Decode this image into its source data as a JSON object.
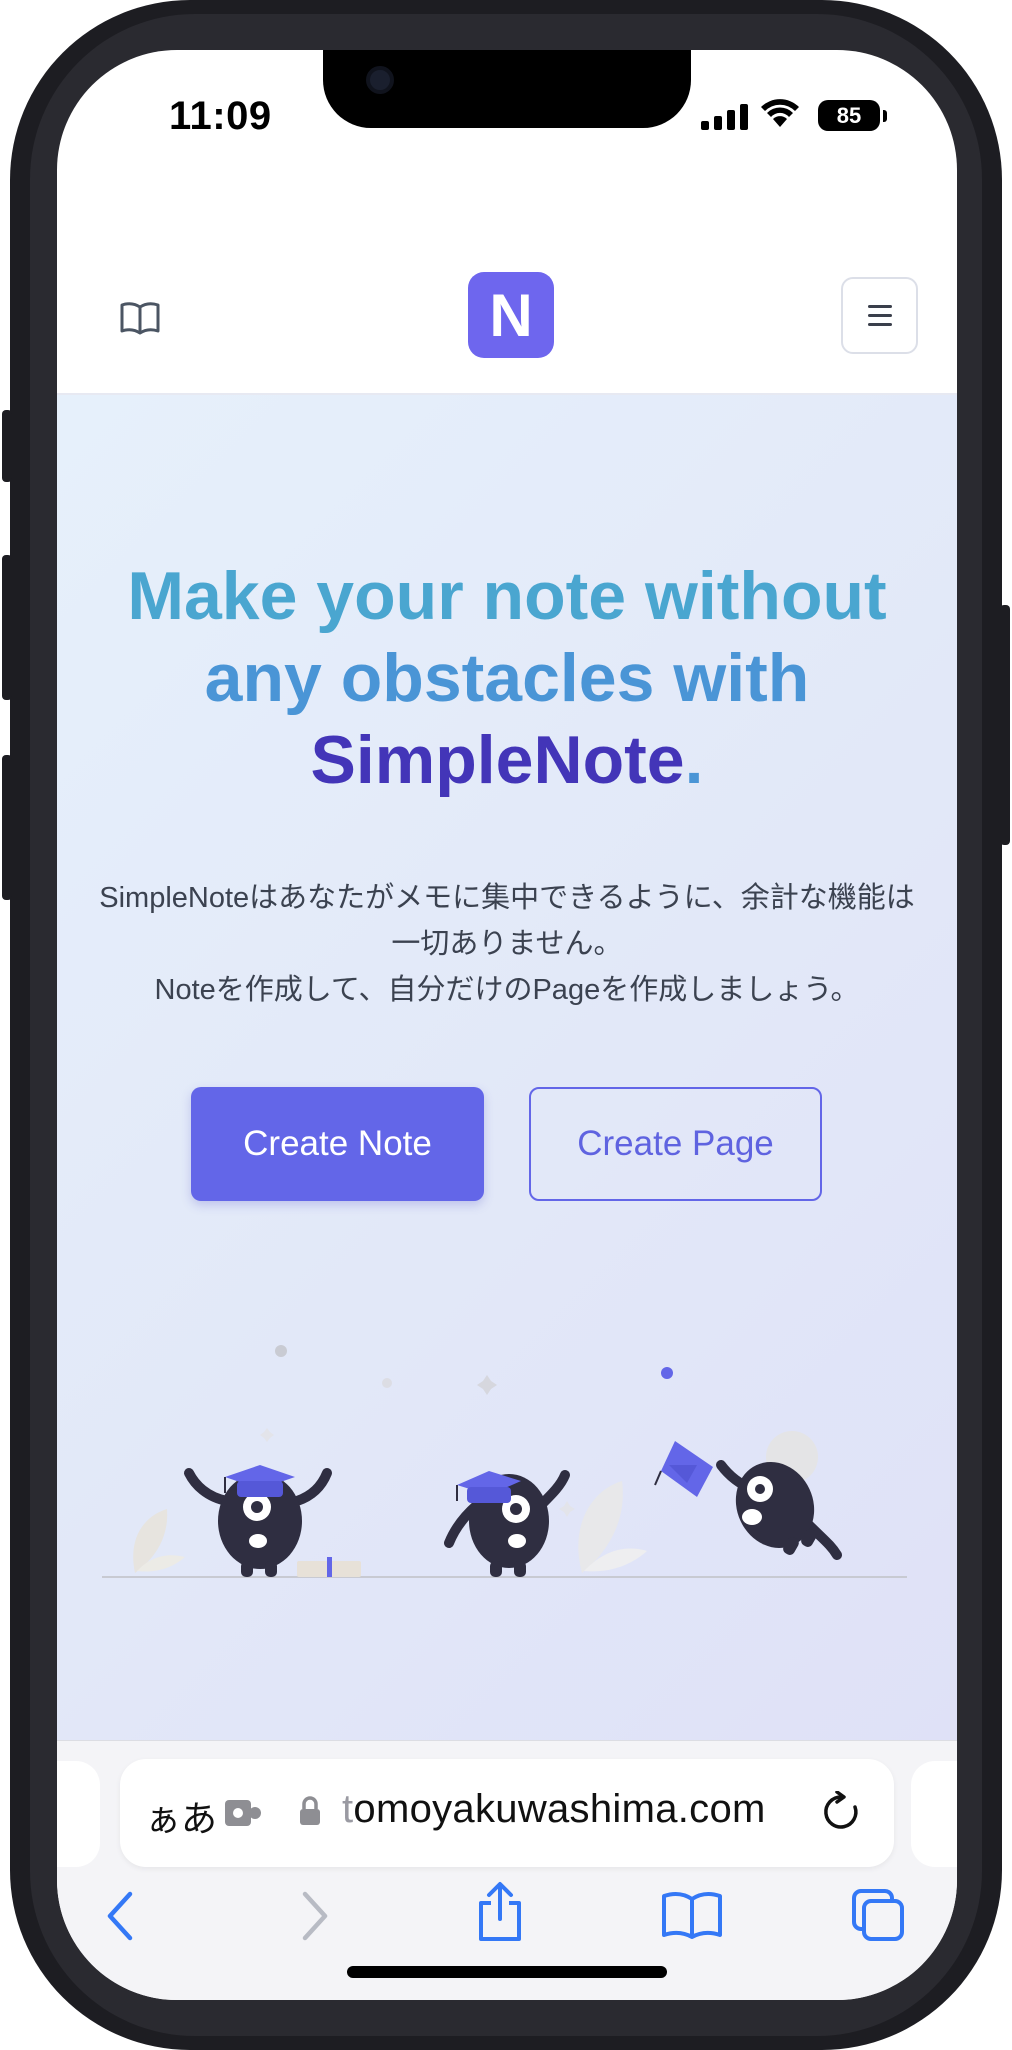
{
  "status_bar": {
    "time": "11:09",
    "battery": "85"
  },
  "header": {
    "logo_letter": "N",
    "icons": [
      "book-icon",
      "hamburger-menu-icon"
    ]
  },
  "hero": {
    "headline_line1": "Make your note without",
    "headline_line2": "any obstacles with",
    "headline_brand": "SimpleNote",
    "headline_dot": ".",
    "subtext_line1": "SimpleNoteはあなたがメモに集中できるように、余計な機能は一切ありません。",
    "subtext_line2": "Noteを作成して、自分だけのPageを作成しましょう。",
    "primary_button": "Create Note",
    "secondary_button": "Create Page"
  },
  "browser": {
    "aa_label": "ぁあ",
    "url_first_char": "t",
    "url_rest": "omoyakuwashima.com",
    "icons": [
      "extension-icon",
      "lock-icon",
      "reload-icon",
      "back-icon",
      "forward-icon",
      "share-icon",
      "bookmarks-icon",
      "tabs-icon"
    ]
  },
  "colors": {
    "brand": "#6e66ee",
    "primary_button": "#6366e8",
    "headline_blue": "#4a95d6",
    "headline_brand": "#4335b8"
  }
}
